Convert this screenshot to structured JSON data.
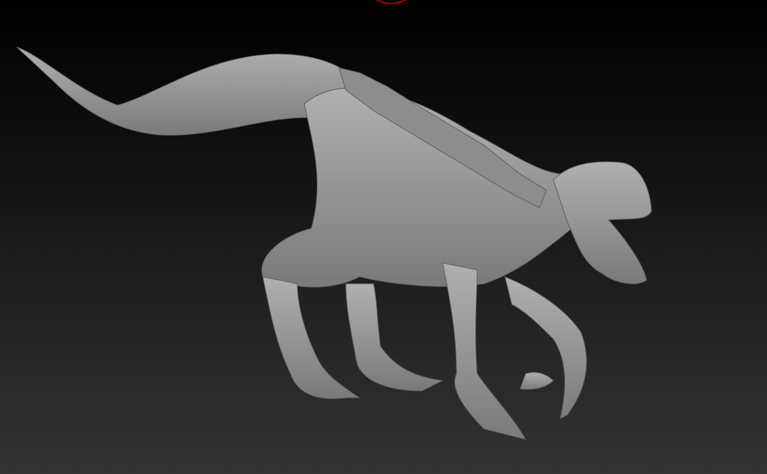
{
  "viewport": {
    "background_top": "#000000",
    "background_bottom": "#333333",
    "brush_cursor_color": "#b00000",
    "model_color": "#9a9a9a"
  }
}
